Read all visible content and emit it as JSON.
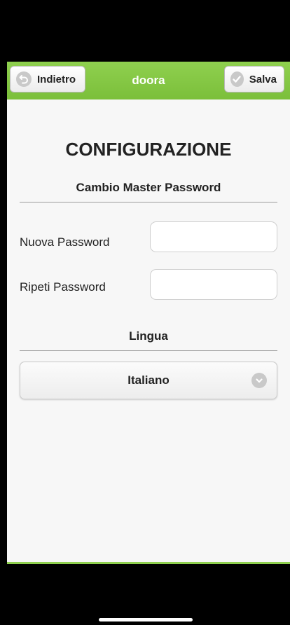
{
  "header": {
    "title": "doora",
    "back_label": "Indietro",
    "save_label": "Salva",
    "color": "#7bbf3a"
  },
  "page": {
    "title": "CONFIGURAZIONE"
  },
  "password_section": {
    "heading": "Cambio Master Password",
    "new_password_label": "Nuova Password",
    "new_password_value": "",
    "repeat_password_label": "Ripeti Password",
    "repeat_password_value": ""
  },
  "language_section": {
    "heading": "Lingua",
    "selected": "Italiano",
    "icon": "chevron-down-icon"
  }
}
